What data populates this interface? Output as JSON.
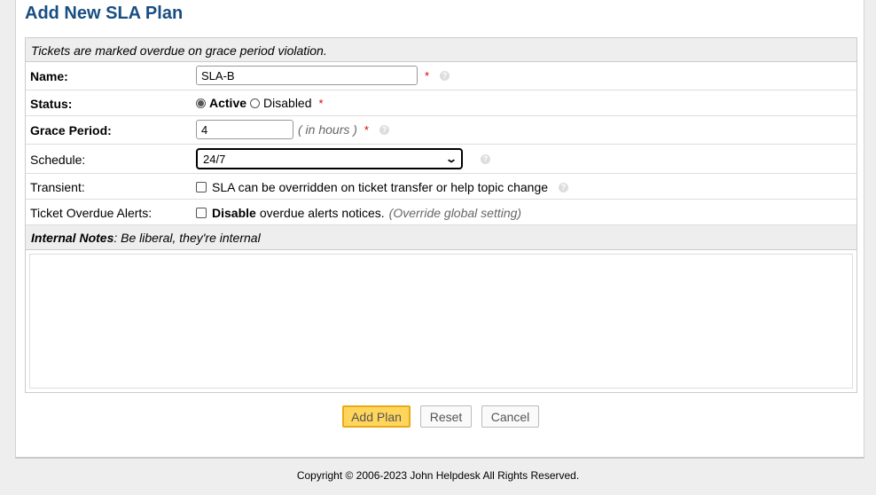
{
  "page_title": "Add New SLA Plan",
  "header_note": "Tickets are marked overdue on grace period violation.",
  "fields": {
    "name": {
      "label": "Name:",
      "value": "SLA-B",
      "required": "*"
    },
    "status": {
      "label": "Status:",
      "options": [
        "Active",
        "Disabled"
      ],
      "selected": "Active",
      "required": "*"
    },
    "grace_period": {
      "label": "Grace Period:",
      "value": "4",
      "hint": "( in hours )",
      "required": "*"
    },
    "schedule": {
      "label": "Schedule:",
      "selected": "24/7"
    },
    "transient": {
      "label": "Transient:",
      "checkbox_label": "SLA can be overridden on ticket transfer or help topic change"
    },
    "overdue_alerts": {
      "label": "Ticket Overdue Alerts:",
      "checkbox_bold": "Disable",
      "checkbox_label": "overdue alerts notices.",
      "hint": "(Override global setting)"
    }
  },
  "notes": {
    "title": "Internal Notes",
    "subtitle": ": Be liberal, they're internal"
  },
  "buttons": {
    "add": "Add Plan",
    "reset": "Reset",
    "cancel": "Cancel"
  },
  "footer": "Copyright © 2006-2023 John Helpdesk All Rights Reserved.",
  "colors": {
    "title": "#184E81",
    "primary_button": "#FFD55B",
    "required": "#dd0000"
  }
}
